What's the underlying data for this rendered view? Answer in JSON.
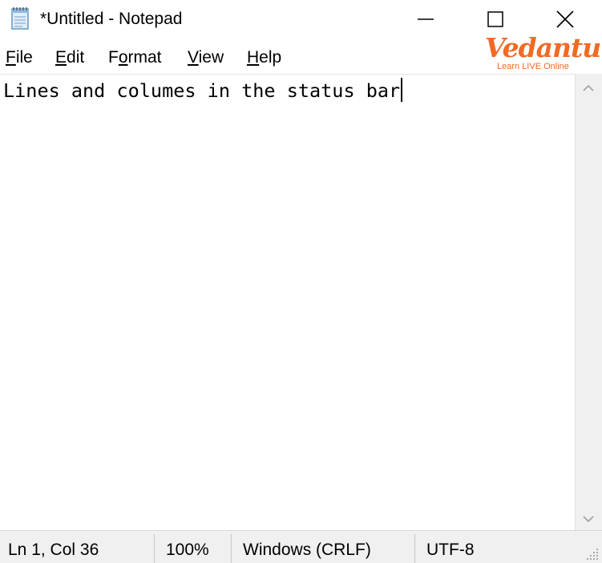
{
  "window": {
    "title": "*Untitled - Notepad",
    "app_icon": "notepad-icon",
    "controls": [
      "minimize-icon",
      "maximize-icon",
      "close-icon"
    ]
  },
  "menu": {
    "items": [
      {
        "accel": "F",
        "rest": "ile"
      },
      {
        "accel": "E",
        "rest": "dit"
      },
      {
        "pre": "F",
        "accel": "o",
        "rest": "rmat"
      },
      {
        "accel": "V",
        "rest": "iew"
      },
      {
        "accel": "H",
        "rest": "elp"
      }
    ]
  },
  "watermark": {
    "brand": "Vedantu",
    "tagline": "Learn LIVE Online",
    "color": "#f06a24"
  },
  "editor": {
    "content": "Lines and columes in the status bar"
  },
  "status": {
    "position": "Ln 1, Col 36",
    "zoom": "100%",
    "line_ending": "Windows (CRLF)",
    "encoding": "UTF-8"
  }
}
